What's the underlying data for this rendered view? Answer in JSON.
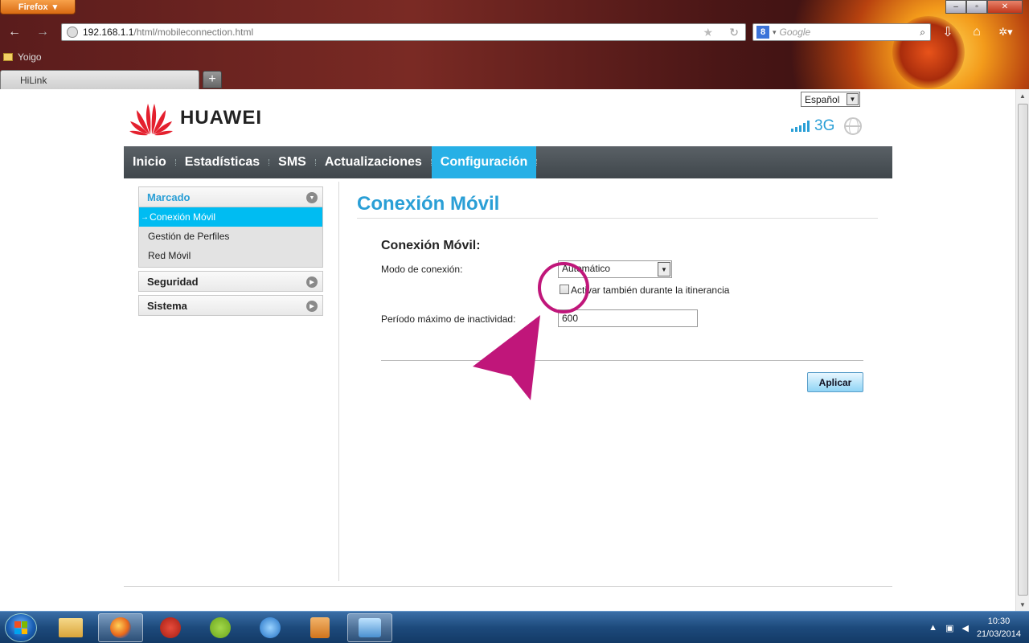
{
  "browser": {
    "menu_label": "Firefox",
    "url_host": "192.168.1.1",
    "url_path": "/html/mobileconnection.html",
    "search_engine_letter": "8",
    "search_placeholder": "Google",
    "bookmark": "Yoigo",
    "tab_title": "HiLink",
    "newtab_label": "+"
  },
  "header": {
    "brand": "HUAWEI",
    "language": "Español",
    "network_type": "3G"
  },
  "nav": {
    "items": [
      "Inicio",
      "Estadísticas",
      "SMS",
      "Actualizaciones",
      "Configuración"
    ],
    "active": "Configuración"
  },
  "sidebar": {
    "sections": [
      {
        "title": "Marcado",
        "items": [
          "Conexión Móvil",
          "Gestión de Perfiles",
          "Red Móvil"
        ],
        "active_item": "Conexión Móvil"
      },
      {
        "title": "Seguridad"
      },
      {
        "title": "Sistema"
      }
    ]
  },
  "main": {
    "title": "Conexión Móvil",
    "form_heading": "Conexión Móvil:",
    "mode_label": "Modo de conexión:",
    "mode_value": "Automático",
    "roaming_label": "Activar también durante la itinerancia",
    "roaming_checked": false,
    "idle_label": "Período máximo de inactividad:",
    "idle_value": "600",
    "apply_label": "Aplicar"
  },
  "taskbar": {
    "time": "10:30",
    "date": "21/03/2014"
  },
  "colors": {
    "accent": "#27b0e6",
    "annotation": "#c0167a",
    "nav_bg": "#4a5156"
  }
}
